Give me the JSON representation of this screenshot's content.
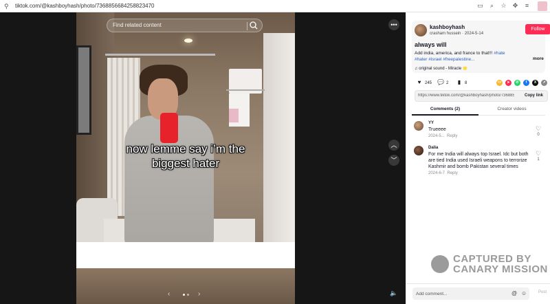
{
  "browser": {
    "url": "tiktok.com/@kashboyhash/photo/7368856684258823470"
  },
  "search": {
    "placeholder": "Find related content"
  },
  "video": {
    "caption_line1": "now lemme say i’m the",
    "caption_line2": "biggest hater"
  },
  "post": {
    "username": "kashboyhash",
    "display_name": "crasham hussein",
    "date": "2024-5-14",
    "follow_label": "Follow",
    "title": "always will",
    "description_text": "Add india, america, and france to that!!! ",
    "hashtags": [
      "#hate",
      "#hater",
      "#israel",
      "#freepalestine..."
    ],
    "more_label": "more",
    "sound": "original sound - Miracle 🌟"
  },
  "actions": {
    "likes": "245",
    "comments": "2",
    "saves": "8"
  },
  "share": {
    "link": "https://www.tiktok.com/@kashboyhash/photo/7368856684258823470",
    "copy_label": "Copy link"
  },
  "tabs": [
    {
      "label": "Comments (2)"
    },
    {
      "label": "Creator videos"
    }
  ],
  "comments": [
    {
      "name": "YY",
      "text": "Trueeee",
      "date": "2024-5...",
      "reply": "Reply",
      "likes": "0"
    },
    {
      "name": "Dalia",
      "text": "For me India will always top Israel. Idc but both are tied India used Israeli weapons to terrorize Kashmir and bomb Pakistan several times",
      "date": "2024-6-7",
      "reply": "Reply",
      "likes": "1"
    }
  ],
  "comment_bar": {
    "placeholder": "Add comment...",
    "post_label": "Post"
  },
  "watermark": {
    "line1": "CAPTURED BY",
    "line2": "CANARY MISSION"
  },
  "colors": {
    "follow": "#fe2c55",
    "hashtag": "#2b5db9",
    "video_bg": "#161616"
  }
}
